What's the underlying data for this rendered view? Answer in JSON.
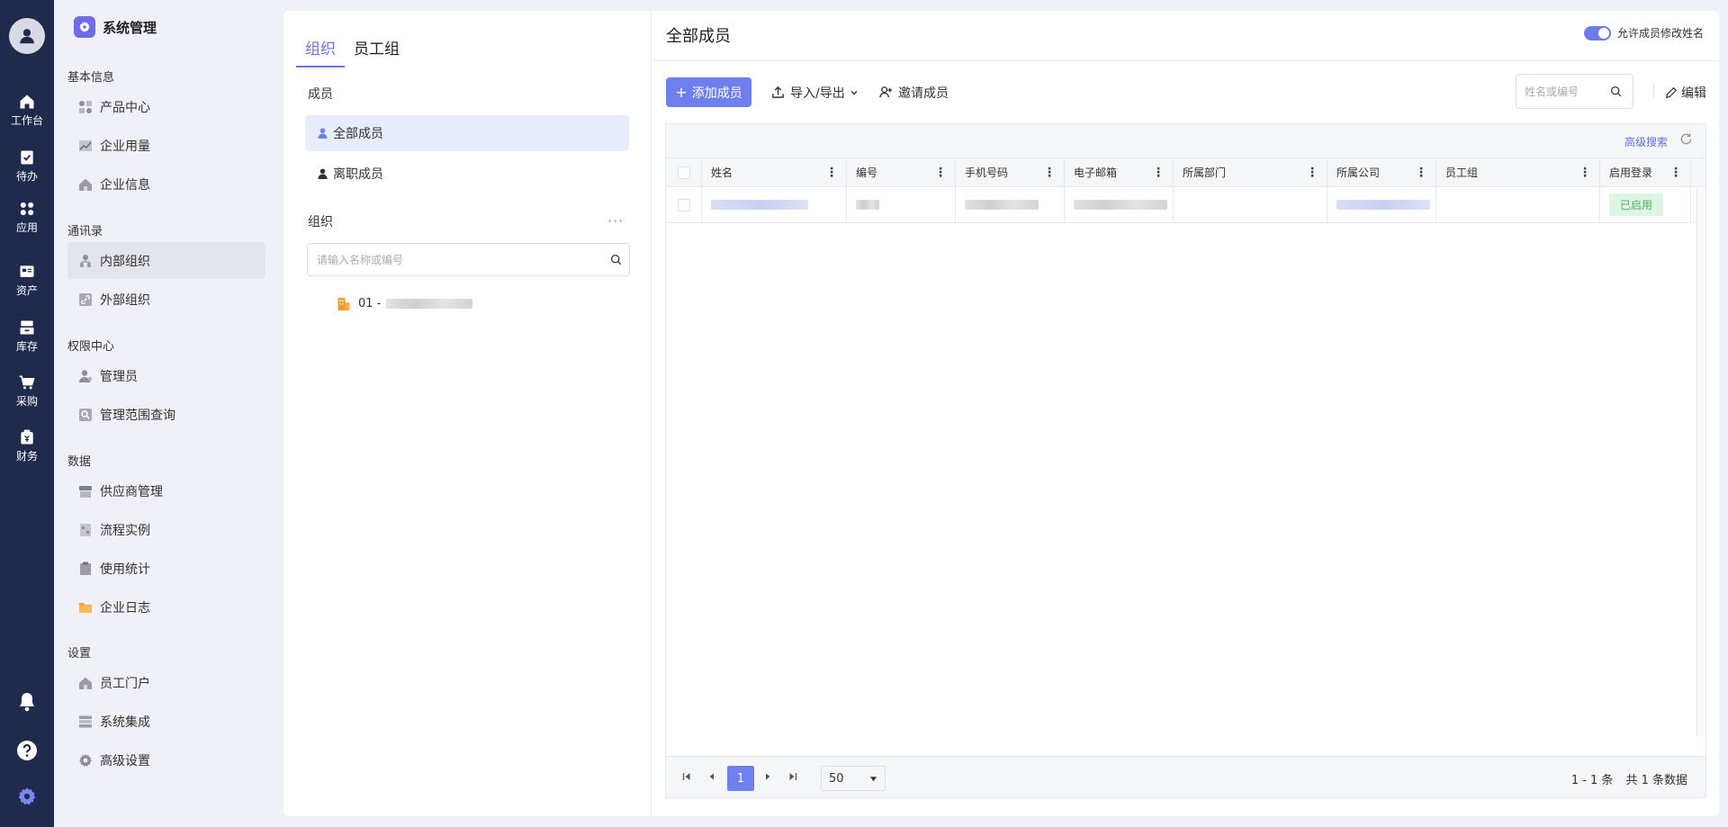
{
  "rail": {
    "items": [
      {
        "label": "工作台",
        "icon": "home-icon"
      },
      {
        "label": "待办",
        "icon": "todo-icon"
      },
      {
        "label": "应用",
        "icon": "apps-icon"
      },
      {
        "label": "资产",
        "icon": "assets-icon"
      },
      {
        "label": "库存",
        "icon": "inventory-icon"
      },
      {
        "label": "采购",
        "icon": "cart-icon"
      },
      {
        "label": "财务",
        "icon": "finance-icon"
      }
    ]
  },
  "menu": {
    "title": "系统管理",
    "groups": [
      {
        "title": "基本信息",
        "items": [
          "产品中心",
          "企业用量",
          "企业信息"
        ]
      },
      {
        "title": "通讯录",
        "items": [
          "内部组织",
          "外部组织"
        ]
      },
      {
        "title": "权限中心",
        "items": [
          "管理员",
          "管理范围查询"
        ]
      },
      {
        "title": "数据",
        "items": [
          "供应商管理",
          "流程实例",
          "使用统计",
          "企业日志"
        ]
      },
      {
        "title": "设置",
        "items": [
          "员工门户",
          "系统集成",
          "高级设置"
        ]
      }
    ],
    "active_item": "内部组织"
  },
  "org_panel": {
    "tabs": [
      "组织",
      "员工组"
    ],
    "active_tab": "组织",
    "members_title": "成员",
    "member_items": [
      "全部成员",
      "离职成员"
    ],
    "org_title": "组织",
    "more": "···",
    "search_placeholder": "请输入名称或编号",
    "tree": [
      {
        "code": "01 -"
      }
    ]
  },
  "members": {
    "title": "全部成员",
    "toggle_label": "允许成员修改姓名",
    "toggle_on": true,
    "add_button": "添加成员",
    "import_export": "导入/导出",
    "invite": "邀请成员",
    "search_placeholder": "姓名或编号",
    "edit": "编辑",
    "advanced_search": "高级搜索",
    "columns": [
      "姓名",
      "编号",
      "手机号码",
      "电子邮箱",
      "所属部门",
      "所属公司",
      "员工组",
      "启用登录"
    ],
    "rows": [
      {
        "status": "已启用"
      }
    ],
    "pagination": {
      "current_page": "1",
      "page_size": "50",
      "range": "1 - 1 条",
      "total": "共 1 条数据"
    }
  },
  "colors": {
    "rail_bg": "#1f2a4d",
    "accent": "#6f80ee",
    "status_green": "#4caf61"
  }
}
